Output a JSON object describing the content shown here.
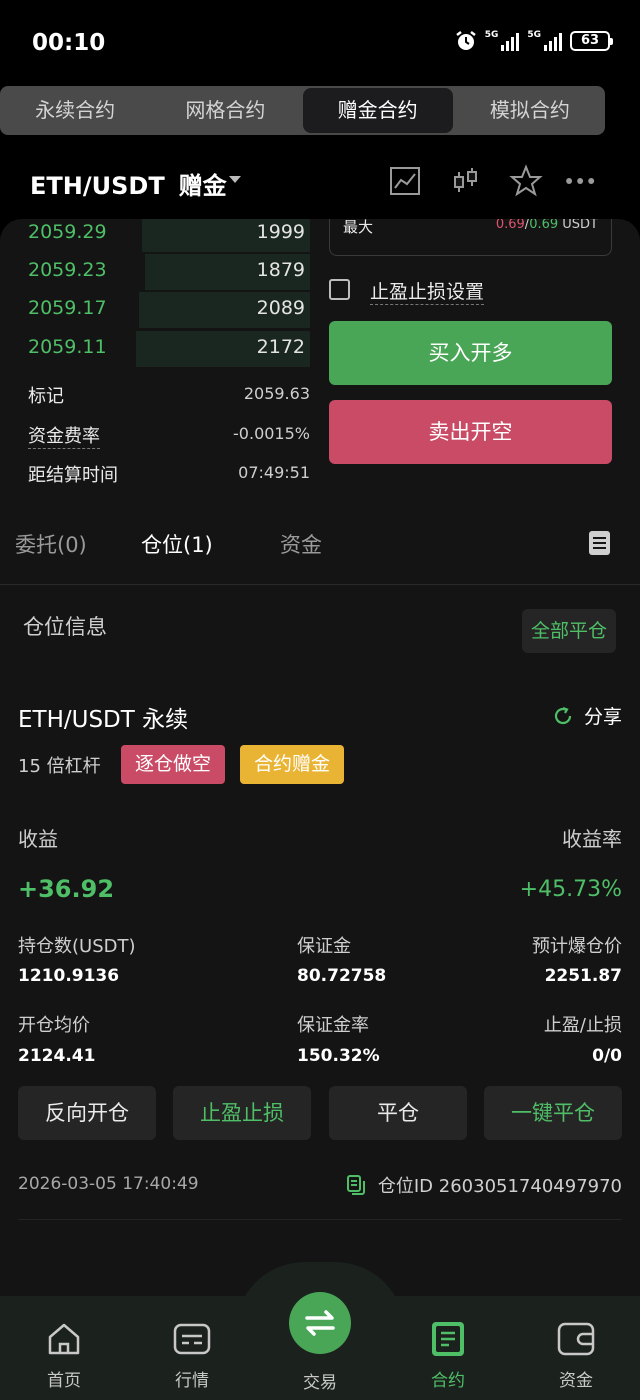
{
  "status_bar": {
    "time": "00:10",
    "net1": "5G",
    "net2": "5G",
    "battery": "63"
  },
  "top_tabs": [
    {
      "label": "永续合约",
      "active": false
    },
    {
      "label": "网格合约",
      "active": false
    },
    {
      "label": "赠金合约",
      "active": true
    },
    {
      "label": "模拟合约",
      "active": false
    }
  ],
  "header": {
    "pair": "ETH/USDT",
    "gift": "赠金"
  },
  "max": {
    "label": "最大",
    "val_red": "0.69",
    "sep": "/",
    "val_green": "0.69",
    "unit": " USDT"
  },
  "orderbook": [
    {
      "price": "2059.29",
      "qty": "1999",
      "depth": 0.56
    },
    {
      "price": "2059.23",
      "qty": "1879",
      "depth": 0.55
    },
    {
      "price": "2059.17",
      "qty": "2089",
      "depth": 0.57
    },
    {
      "price": "2059.11",
      "qty": "2172",
      "depth": 0.58
    }
  ],
  "market_info": {
    "mark_label": "标记",
    "mark_value": "2059.63",
    "funding_label": "资金费率",
    "funding_value": "-0.0015%",
    "settle_label": "距结算时间",
    "settle_value": "07:49:51"
  },
  "order_form": {
    "tpsl_label": "止盈止损设置",
    "buy_label": "买入开多",
    "sell_label": "卖出开空"
  },
  "sub_tabs": {
    "orders": "委托(0)",
    "positions": "仓位(1)",
    "funds": "资金"
  },
  "section": {
    "title": "仓位信息",
    "close_all": "全部平仓"
  },
  "position": {
    "title": "ETH/USDT 永续",
    "share": "分享",
    "leverage": "15 倍杠杆",
    "badge_mode": "逐仓做空",
    "badge_type": "合约赠金",
    "pnl_label": "收益",
    "pnl_rate_label": "收益率",
    "pnl": "+36.92",
    "pnl_rate": "+45.73%",
    "size_label": "持仓数(USDT)",
    "size": "1210.9136",
    "margin_label": "保证金",
    "margin": "80.72758",
    "liq_label": "预计爆仓价",
    "liq": "2251.87",
    "entry_label": "开仓均价",
    "entry": "2124.41",
    "margin_rate_label": "保证金率",
    "margin_rate": "150.32%",
    "tpsl_label": "止盈/止损",
    "tpsl": "0/0",
    "time": "2026-03-05 17:40:49",
    "id_text": "仓位ID 2603051740497970"
  },
  "actions": {
    "reverse": "反向开仓",
    "tpsl": "止盈止损",
    "close": "平仓",
    "close_one_click": "一键平仓"
  },
  "nav": {
    "home": "首页",
    "market": "行情",
    "trade": "交易",
    "contract": "合约",
    "assets": "资金"
  },
  "colors": {
    "green": "#4fbf67",
    "red": "#c94b66",
    "yellow": "#e9b434",
    "bg": "#141414"
  }
}
